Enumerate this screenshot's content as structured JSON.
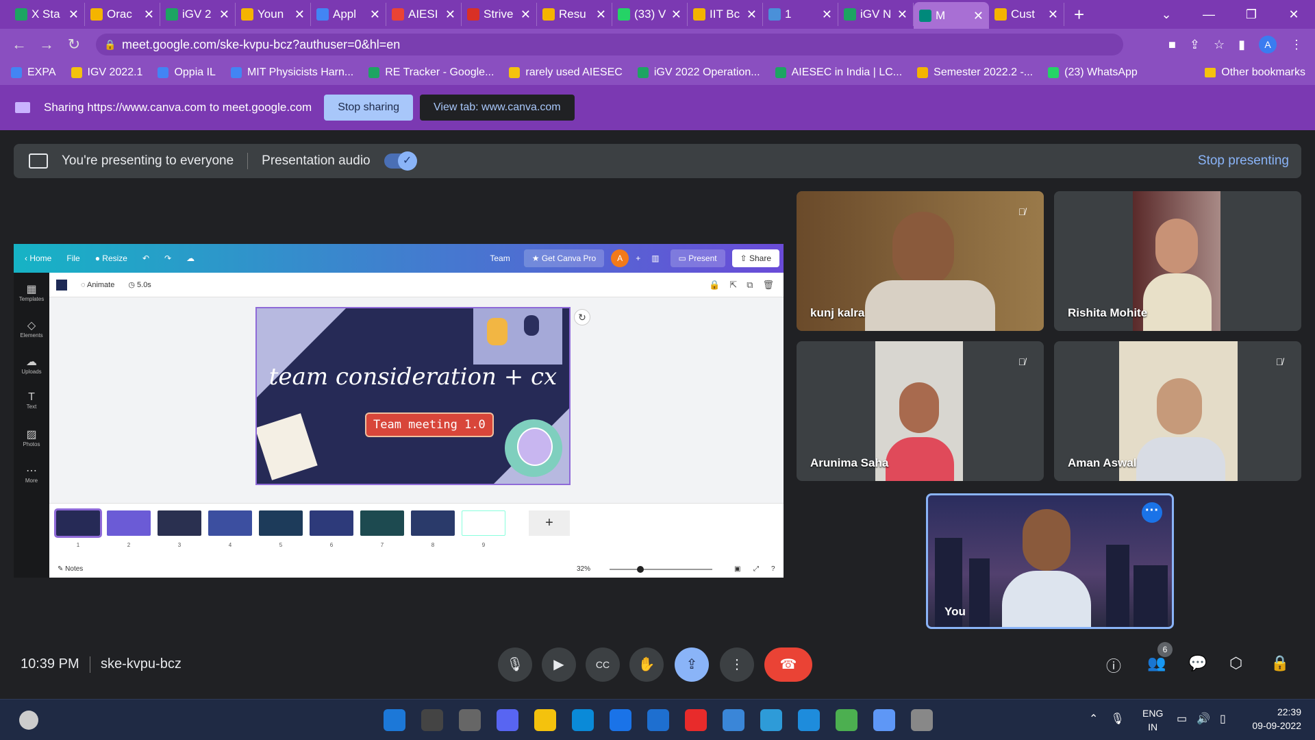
{
  "browser": {
    "tabs": [
      {
        "title": "X Sta",
        "color": "#1da462"
      },
      {
        "title": "Orac",
        "color": "#f4b400"
      },
      {
        "title": "iGV 2",
        "color": "#1da462"
      },
      {
        "title": "Youn",
        "color": "#f4b400"
      },
      {
        "title": "Appl",
        "color": "#4285f4"
      },
      {
        "title": "AIESI",
        "color": "#ea4335"
      },
      {
        "title": "Strive",
        "color": "#d93025"
      },
      {
        "title": "Resu",
        "color": "#f4b400"
      },
      {
        "title": "(33) V",
        "color": "#25d366"
      },
      {
        "title": "IIT Bc",
        "color": "#f4b400"
      },
      {
        "title": "1",
        "color": "#4a90d9"
      },
      {
        "title": "iGV N",
        "color": "#1da462"
      },
      {
        "title": "M",
        "color": "#00897b"
      },
      {
        "title": "Cust",
        "color": "#f4b400"
      }
    ],
    "active_tab_index": 12,
    "url": "meet.google.com/ske-kvpu-bcz?authuser=0&hl=en",
    "profile_initial": "A",
    "bookmarks": [
      {
        "label": "EXPA",
        "color": "#4285f4"
      },
      {
        "label": "IGV 2022.1",
        "color": "#f4c20d"
      },
      {
        "label": "Oppia IL",
        "color": "#4285f4"
      },
      {
        "label": "MIT Physicists Harn...",
        "color": "#4285f4"
      },
      {
        "label": "RE Tracker - Google...",
        "color": "#1da462"
      },
      {
        "label": "rarely used AIESEC",
        "color": "#f4c20d"
      },
      {
        "label": "iGV 2022 Operation...",
        "color": "#1da462"
      },
      {
        "label": "AIESEC in India | LC...",
        "color": "#1da462"
      },
      {
        "label": "Semester 2022.2 -...",
        "color": "#f4b400"
      },
      {
        "label": "(23) WhatsApp",
        "color": "#25d366"
      }
    ],
    "other_bookmarks": "Other bookmarks"
  },
  "sharing_bar": {
    "text": "Sharing https://www.canva.com to meet.google.com",
    "stop_label": "Stop sharing",
    "view_label": "View tab: www.canva.com"
  },
  "presenting_banner": {
    "text": "You're presenting to everyone",
    "audio_label": "Presentation audio",
    "audio_on": true,
    "stop_label": "Stop presenting"
  },
  "canva": {
    "top_left": [
      "Home",
      "File",
      "Resize"
    ],
    "team": "Team",
    "pro": "Get Canva Pro",
    "user_initial": "A",
    "present": "Present",
    "share": "Share",
    "side": [
      "Templates",
      "Elements",
      "Uploads",
      "Text",
      "Photos",
      "More"
    ],
    "animate": "Animate",
    "duration": "5.0s",
    "slide_title": "team consideration + cx",
    "slide_tag": "Team meeting 1.0",
    "thumb_numbers": [
      "1",
      "2",
      "3",
      "4",
      "5",
      "6",
      "7",
      "8",
      "9"
    ],
    "thumb_colors": [
      "#262a56",
      "#6b5bd6",
      "#2a3050",
      "#3c4fa0",
      "#1d3b5a",
      "#2d3a7a",
      "#1d4a50",
      "#2a3a6a",
      "#ffffff"
    ],
    "selected_thumb": 1,
    "notes": "Notes",
    "zoom": "32%"
  },
  "participants": [
    {
      "name": "kunj kalra",
      "muted": true,
      "skin": "#8a5a3c",
      "bg": "#8a6a3a"
    },
    {
      "name": "Rishita Mohite",
      "muted": false,
      "skin": "#c89276",
      "bg": "#5a2a2a"
    },
    {
      "name": "Arunima Saha",
      "muted": true,
      "skin": "#a86a4e",
      "bg": "#d8d6d0"
    },
    {
      "name": "Aman Aswal",
      "muted": true,
      "skin": "#c69a7a",
      "bg": "#e4dcc8"
    }
  ],
  "self": {
    "name": "You"
  },
  "meeting": {
    "time": "10:39 PM",
    "code": "ske-kvpu-bcz",
    "people_count": "6"
  },
  "taskbar": {
    "lang_1": "ENG",
    "lang_2": "IN",
    "clock_time": "22:39",
    "clock_date": "09-09-2022",
    "apps": [
      "#1c78d8",
      "#444",
      "#666",
      "#5865f2",
      "#f4c20d",
      "#0a8ad8",
      "#1a73e8",
      "#1e6fd0",
      "#e82b2b",
      "#3a86d8",
      "#2e9bd8",
      "#1e8cdc",
      "#4caf50",
      "#5e97f6",
      "#888"
    ]
  }
}
